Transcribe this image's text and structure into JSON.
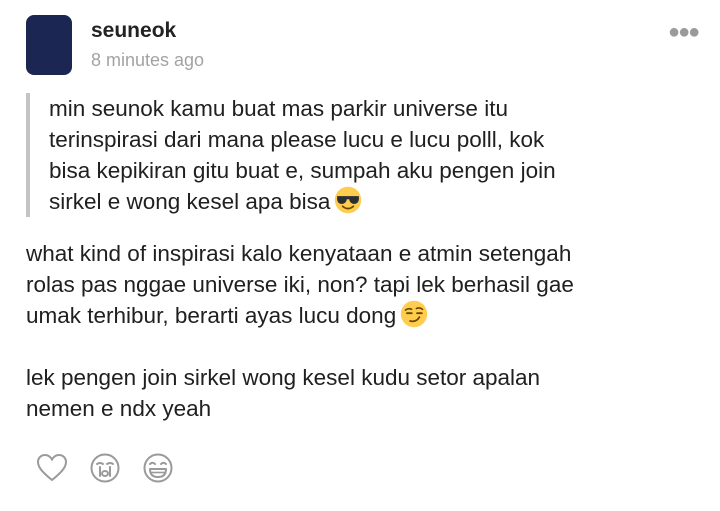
{
  "post": {
    "username": "seuneok",
    "timestamp": "8 minutes ago",
    "more_icon": "more-options-icon"
  },
  "question": {
    "text": "min seunok kamu buat mas parkir universe itu\nterinspirasi dari mana please lucu e lucu polll, kok\nbisa kepikiran gitu buat e, sumpah aku pengen join\nsirkel e wong kesel apa bisa",
    "emoji": "smiling-face-with-sunglasses-emoji"
  },
  "answer": {
    "paragraph1": "what kind of inspirasi kalo kenyataan e atmin setengah\nrolas pas nggae universe iki, non? tapi lek berhasil gae\numak terhibur, berarti ayas lucu dong",
    "paragraph1_emoji": "smirking-face-emoji",
    "paragraph2": "lek pengen join sirkel wong kesel kudu setor apalan\nnemen e ndx yeah"
  },
  "reactions": [
    {
      "icon": "heart-icon"
    },
    {
      "icon": "crying-face-icon"
    },
    {
      "icon": "laughing-face-icon"
    }
  ]
}
